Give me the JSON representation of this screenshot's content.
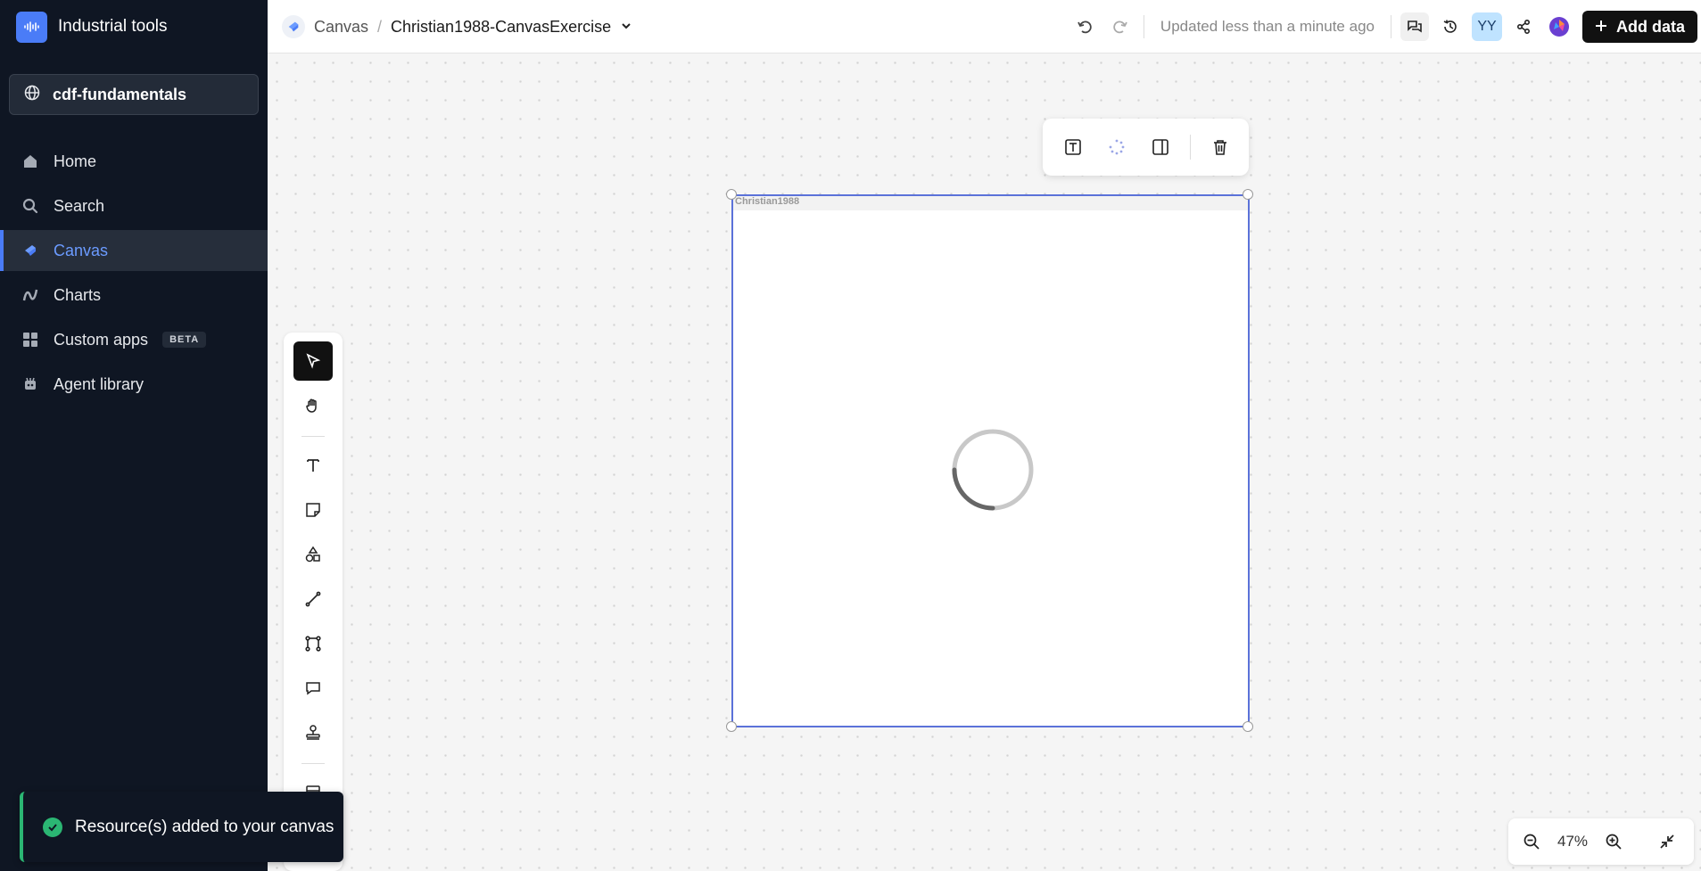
{
  "app": {
    "brand_title": "Industrial tools",
    "project": "cdf-fundamentals"
  },
  "sidebar": {
    "items": [
      {
        "label": "Home",
        "icon": "home-icon"
      },
      {
        "label": "Search",
        "icon": "search-icon"
      },
      {
        "label": "Canvas",
        "icon": "canvas-icon",
        "active": true
      },
      {
        "label": "Charts",
        "icon": "charts-icon"
      },
      {
        "label": "Custom apps",
        "icon": "apps-icon",
        "badge": "BETA"
      },
      {
        "label": "Agent library",
        "icon": "agent-icon"
      }
    ]
  },
  "header": {
    "breadcrumb_root": "Canvas",
    "breadcrumb_sep": "/",
    "canvas_name": "Christian1988-CanvasExercise",
    "updated": "Updated less than a minute ago",
    "avatar_initials": "YY",
    "add_data_label": "Add data"
  },
  "frame": {
    "title": "Christian1988"
  },
  "zoom": {
    "level": "47%"
  },
  "toast": {
    "message": "Resource(s) added to your canvas"
  },
  "colors": {
    "sidebar_bg": "#0f1623",
    "accent": "#4a7cf7",
    "frame_border": "#5b72d9",
    "success": "#2bb673"
  }
}
